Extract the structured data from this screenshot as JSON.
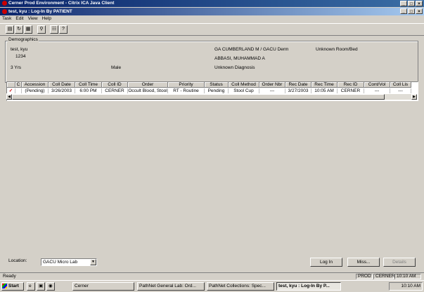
{
  "outer_window": {
    "title": "Cerner Prod Environment - Citrix ICA Java Client"
  },
  "inner_window": {
    "title": "test, kyu : Log-In By PATIENT",
    "min": "_",
    "max": "□",
    "close": "×"
  },
  "menu": [
    "Task",
    "Edit",
    "View",
    "Help"
  ],
  "demographics": {
    "group_label": "Demographics",
    "name": "test, kyu",
    "mrn": "1234",
    "age": "3 Yrs",
    "sex": "Male",
    "location": "GA CUMBERLAND M / GACU Derm",
    "physician": "ABBASI, MUHAMMAD A",
    "diagnosis": "Unknown Diagnosis",
    "room": "Unknown Room/Bed"
  },
  "grid": {
    "columns": [
      "",
      "C",
      "Accession",
      "Coll Date",
      "Coll Time",
      "Coll ID",
      "Order",
      "Priority",
      "Status",
      "Coll Method",
      "Order Nbr",
      "Rec Date",
      "Rec Time",
      "Rec ID",
      "Cont/Vol",
      "Coll Lis"
    ],
    "rows": [
      [
        "",
        "",
        "(Pending)",
        "3/26/2003",
        "6:00 PM",
        "CERNER",
        "Occult Blood, Stool",
        "RT - Routine",
        "Pending",
        "Stool Cup",
        "---",
        "3/27/2003",
        "10:05 AM",
        "CERNER",
        "---",
        "---"
      ]
    ]
  },
  "location": {
    "label": "Location:",
    "value": "GACU Micro Lab"
  },
  "buttons": {
    "login": "Log In",
    "miss": "Miss...",
    "details": "Details"
  },
  "status": {
    "text": "Ready",
    "env": "PROD",
    "user": "CERNER",
    "time": "10:10 AM"
  },
  "taskbar": {
    "start": "Start",
    "tasks": [
      "Cerner",
      "PathNet General Lab: Ord...",
      "PathNet Collections: Spec...",
      "test, kyu : Log-In By P..."
    ],
    "clock": "10:10 AM"
  },
  "colors": {
    "titlebar": "#0a246a",
    "face": "#d4d0c8"
  }
}
